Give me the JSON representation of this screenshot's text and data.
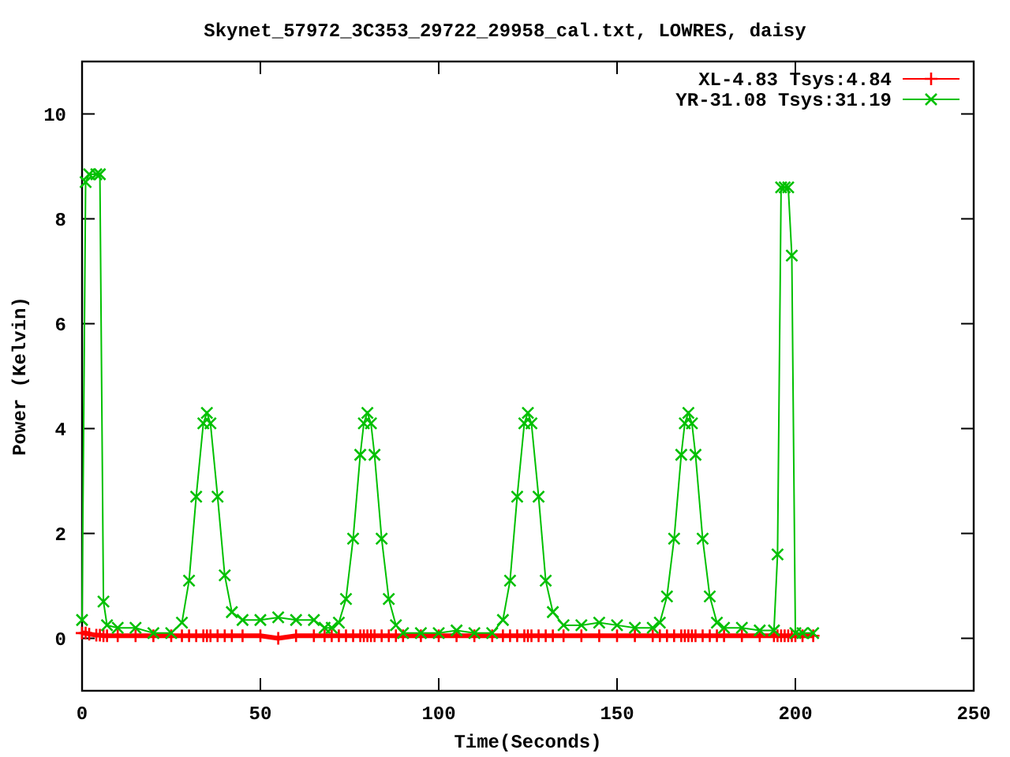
{
  "chart_data": {
    "type": "line",
    "title": "Skynet_57972_3C353_29722_29958_cal.txt, LOWRES, daisy",
    "xlabel": "Time(Seconds)",
    "ylabel": "Power (Kelvin)",
    "xlim": [
      0,
      250
    ],
    "ylim": [
      -1,
      11
    ],
    "xticks": [
      0,
      50,
      100,
      150,
      200,
      250
    ],
    "yticks": [
      0,
      2,
      4,
      6,
      8,
      10
    ],
    "legend": true,
    "x": [
      0,
      1,
      2,
      4,
      5,
      6,
      7,
      10,
      15,
      20,
      25,
      28,
      30,
      32,
      34,
      35,
      36,
      38,
      40,
      42,
      45,
      50,
      55,
      60,
      65,
      68,
      70,
      72,
      74,
      76,
      78,
      79,
      80,
      81,
      82,
      84,
      86,
      88,
      90,
      95,
      100,
      105,
      110,
      115,
      118,
      120,
      122,
      124,
      125,
      126,
      128,
      130,
      132,
      135,
      140,
      145,
      150,
      155,
      160,
      162,
      164,
      166,
      168,
      169,
      170,
      171,
      172,
      174,
      176,
      178,
      180,
      185,
      190,
      194,
      195,
      196,
      197,
      198,
      199,
      200,
      202,
      205
    ],
    "series": [
      {
        "name": "XL-4.83 Tsys:4.84",
        "color": "#ff0000",
        "marker": "plus",
        "values": [
          0.1,
          0.1,
          0.08,
          0.06,
          0.06,
          0.05,
          0.05,
          0.05,
          0.05,
          0.05,
          0.05,
          0.05,
          0.05,
          0.05,
          0.05,
          0.05,
          0.05,
          0.05,
          0.05,
          0.05,
          0.05,
          0.05,
          0.0,
          0.05,
          0.05,
          0.05,
          0.05,
          0.05,
          0.05,
          0.05,
          0.05,
          0.05,
          0.05,
          0.05,
          0.05,
          0.05,
          0.05,
          0.05,
          0.05,
          0.05,
          0.05,
          0.05,
          0.05,
          0.05,
          0.05,
          0.05,
          0.05,
          0.05,
          0.05,
          0.05,
          0.05,
          0.05,
          0.05,
          0.05,
          0.05,
          0.05,
          0.05,
          0.05,
          0.05,
          0.05,
          0.05,
          0.05,
          0.05,
          0.05,
          0.05,
          0.05,
          0.05,
          0.05,
          0.05,
          0.05,
          0.05,
          0.05,
          0.05,
          0.05,
          0.05,
          0.05,
          0.05,
          0.05,
          0.05,
          0.05,
          0.05,
          0.05
        ]
      },
      {
        "name": "YR-31.08 Tsys:31.19",
        "color": "#00c000",
        "marker": "cross",
        "values": [
          0.35,
          8.7,
          8.85,
          8.85,
          8.85,
          0.7,
          0.25,
          0.2,
          0.2,
          0.1,
          0.1,
          0.3,
          1.1,
          2.7,
          4.1,
          4.3,
          4.1,
          2.7,
          1.2,
          0.5,
          0.35,
          0.35,
          0.4,
          0.35,
          0.35,
          0.2,
          0.2,
          0.3,
          0.75,
          1.9,
          3.5,
          4.1,
          4.3,
          4.1,
          3.5,
          1.9,
          0.75,
          0.25,
          0.1,
          0.1,
          0.1,
          0.15,
          0.1,
          0.1,
          0.35,
          1.1,
          2.7,
          4.1,
          4.3,
          4.1,
          2.7,
          1.1,
          0.5,
          0.25,
          0.25,
          0.3,
          0.25,
          0.2,
          0.2,
          0.3,
          0.8,
          1.9,
          3.5,
          4.1,
          4.3,
          4.1,
          3.5,
          1.9,
          0.8,
          0.3,
          0.2,
          0.2,
          0.15,
          0.15,
          1.6,
          8.6,
          8.6,
          8.6,
          7.3,
          0.1,
          0.1,
          0.1
        ]
      }
    ]
  }
}
